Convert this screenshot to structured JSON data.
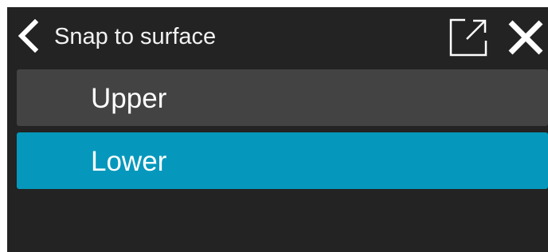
{
  "header": {
    "title": "Snap to surface",
    "back_icon": "chevron-left-icon",
    "popout_icon": "external-link-icon",
    "close_icon": "close-icon"
  },
  "options": [
    {
      "label": "Upper",
      "selected": false
    },
    {
      "label": "Lower",
      "selected": true
    }
  ],
  "colors": {
    "panel_background": "#232323",
    "option_background": "#434343",
    "selected_background": "#0598bc",
    "text": "#ffffff"
  }
}
